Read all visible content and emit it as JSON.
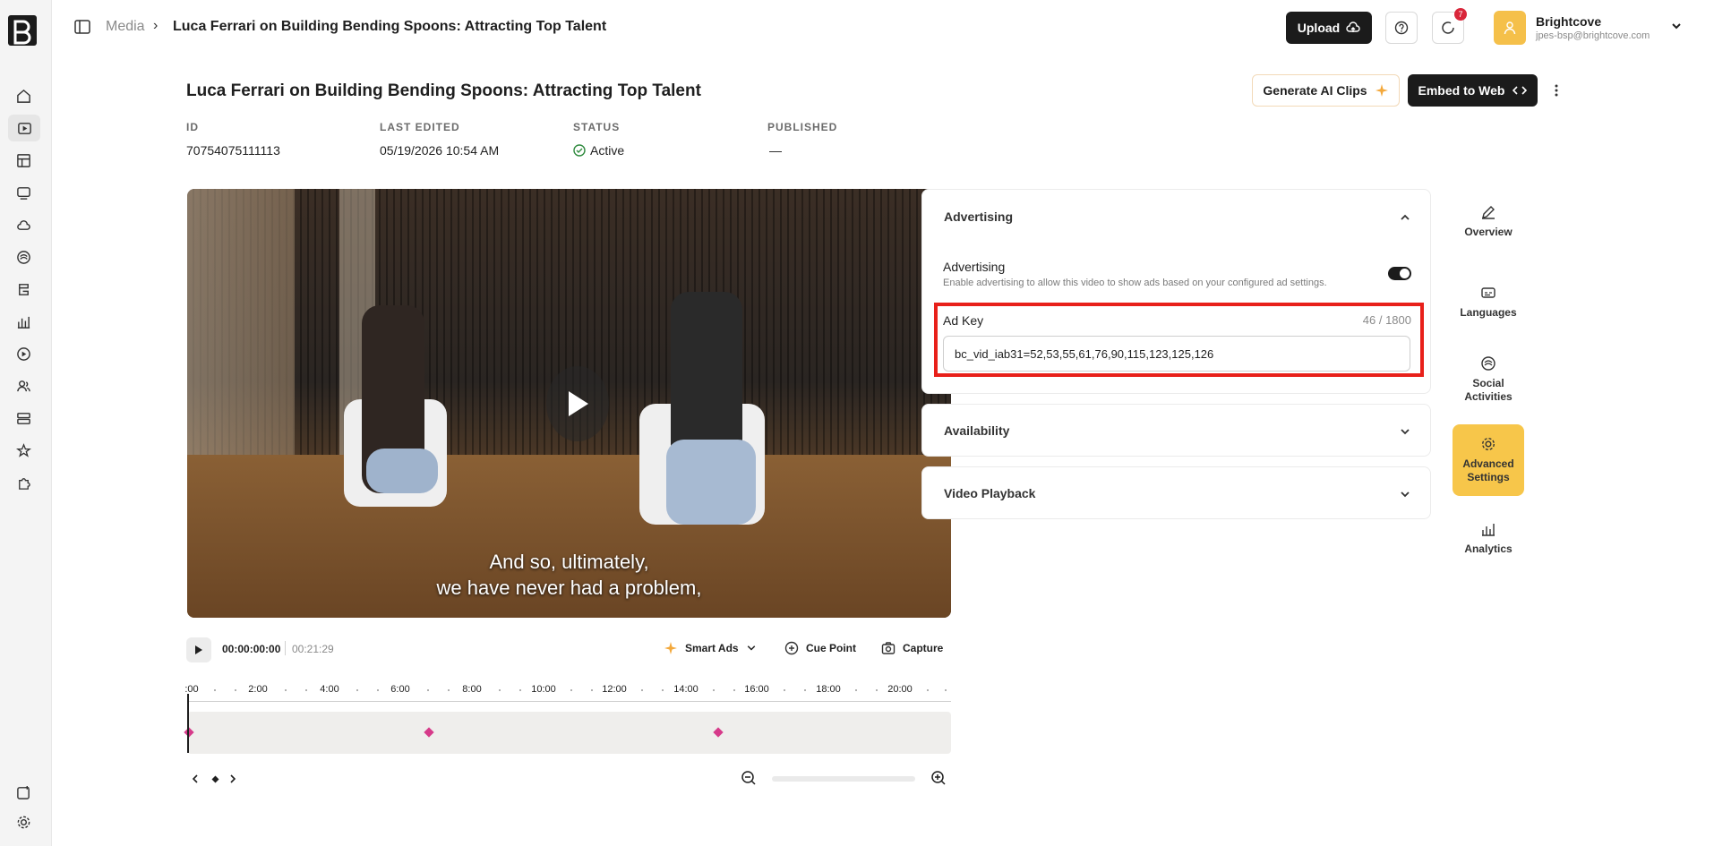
{
  "breadcrumb": {
    "root": "Media",
    "separator": "›",
    "current": "Luca Ferrari on Building Bending Spoons: Attracting Top Talent"
  },
  "header": {
    "upload_label": "Upload",
    "notification_count": "7",
    "account_name": "Brightcove",
    "account_email": "jpes-bsp@brightcove.com"
  },
  "video": {
    "title": "Luca Ferrari on Building Bending Spoons: Attracting Top Talent",
    "ai_clips_label": "Generate AI Clips",
    "embed_label": "Embed to Web",
    "meta": [
      {
        "label": "ID",
        "value": "70754075111113"
      },
      {
        "label": "LAST EDITED",
        "value": "05/19/2026 10:54 AM"
      },
      {
        "label": "STATUS",
        "value": "Active"
      },
      {
        "label": "PUBLISHED",
        "value": "—"
      }
    ],
    "subtitle_line1": "And so, ultimately,",
    "subtitle_line2": "we have never had a problem,"
  },
  "player": {
    "current_time": "00:00:00:00",
    "duration": "00:21:29",
    "smart_ads_label": "Smart Ads",
    "cue_point_label": "Cue Point",
    "capture_label": "Capture",
    "ruler_labels": [
      ":00",
      "2:00",
      "4:00",
      "6:00",
      "8:00",
      "10:00",
      "12:00",
      "14:00",
      "16:00",
      "18:00",
      "20:00"
    ]
  },
  "panel": {
    "advertising_section": "Advertising",
    "advertising_label": "Advertising",
    "advertising_desc": "Enable advertising to allow this video to show ads based on your configured ad settings.",
    "advertising_enabled": true,
    "ad_key_label": "Ad Key",
    "ad_key_value": "bc_vid_iab31=52,53,55,61,76,90,115,123,125,126",
    "ad_key_count": "46 / 1800",
    "availability_section": "Availability",
    "playback_section": "Video Playback"
  },
  "tabs": {
    "overview": "Overview",
    "languages": "Languages",
    "social_1": "Social",
    "social_2": "Activities",
    "advanced_1": "Advanced",
    "advanced_2": "Settings",
    "analytics": "Analytics"
  },
  "colors": {
    "accent": "#f7c64a",
    "highlight_box": "#e8201a",
    "cue_marker": "#d63a8a",
    "dark_button": "#1b1b1b"
  }
}
